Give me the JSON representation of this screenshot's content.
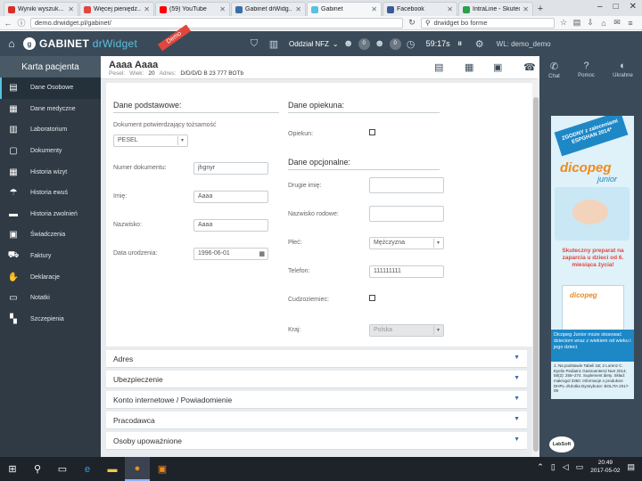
{
  "browser": {
    "tabs": [
      {
        "title": "Wyniki wyszuk...",
        "color": "#d93025",
        "active": false
      },
      {
        "title": "Więcej pieniędz...",
        "color": "#e2463c",
        "active": false
      },
      {
        "title": "(59) YouTube",
        "color": "#ff0000",
        "active": false
      },
      {
        "title": "Gabinet drWidg...",
        "color": "#3b6ea8",
        "active": false
      },
      {
        "title": "Gabinet",
        "color": "#59c1e0",
        "active": true
      },
      {
        "title": "Facebook",
        "color": "#3b5998",
        "active": false
      },
      {
        "title": "IntraLine - Skuteczn...",
        "color": "#2aa14a",
        "active": false
      }
    ],
    "new_tab": "+",
    "url": "demo.drwidget.pl/gabinet/",
    "search": "drwidget bo forme"
  },
  "header": {
    "logo": "GABINET",
    "logo_dr": "drWidget",
    "demo": "Demo",
    "oddzial": "Oddział NFZ",
    "badge1": "0",
    "badge2": "0",
    "time": "59:17s",
    "user": "WL: demo_demo"
  },
  "sidebar": {
    "title": "Karta pacjenta",
    "items": [
      {
        "label": "Dane Osobowe",
        "icon": "id-card-icon",
        "glyph": "▤"
      },
      {
        "label": "Dane medyczne",
        "icon": "medical-file-icon",
        "glyph": "▦"
      },
      {
        "label": "Laboratorium",
        "icon": "lab-icon",
        "glyph": "▥"
      },
      {
        "label": "Dokumenty",
        "icon": "documents-icon",
        "glyph": "▢"
      },
      {
        "label": "Historia wizyt",
        "icon": "calendar-icon",
        "glyph": "▦"
      },
      {
        "label": "Historia ewuś",
        "icon": "umbrella-icon",
        "glyph": "☂"
      },
      {
        "label": "Historia zwolnień",
        "icon": "bed-icon",
        "glyph": "▬"
      },
      {
        "label": "Świadczenia",
        "icon": "clipboard-icon",
        "glyph": "▣"
      },
      {
        "label": "Faktury",
        "icon": "cart-icon",
        "glyph": "⛟"
      },
      {
        "label": "Deklaracje",
        "icon": "handshake-icon",
        "glyph": "✋"
      },
      {
        "label": "Notatki",
        "icon": "notes-icon",
        "glyph": "▭"
      },
      {
        "label": "Szczepienia",
        "icon": "grid-icon",
        "glyph": "▚"
      }
    ]
  },
  "patient": {
    "name": "Aaaa Aaaa",
    "pesel_label": "Pesel:",
    "wiek_label": "Wiek:",
    "wiek": "20",
    "adres_label": "Adres:",
    "adres": "D/D/D/D B 23 777 BOTb"
  },
  "right_panel": {
    "btn1": "Chat",
    "btn2": "Pomoc",
    "btn3": "Ukrahne"
  },
  "form": {
    "basic_title": "Dane podstawowe:",
    "doc_type_label": "Dokument potwierdzający tożsamość",
    "doc_type_value": "PESEL",
    "doc_number_label": "Numer dokumentu:",
    "doc_number_value": "jhgnyr",
    "first_name_label": "Imię:",
    "first_name_value": "Aaaa",
    "last_name_label": "Nazwisko:",
    "last_name_value": "Aaaa",
    "dob_label": "Data urodzenia:",
    "dob_value": "1996-06-01",
    "guardian_title": "Dane opiekuna:",
    "guardian_label": "Opiekun:",
    "optional_title": "Dane opcjonalne:",
    "second_name_label": "Drugie imię:",
    "family_name_label": "Nazwisko rodowe:",
    "sex_label": "Płeć:",
    "sex_value": "Mężczyzna",
    "phone_label": "Telefon:",
    "phone_value": "111111111",
    "foreigner_label": "Cudzoziemiec:",
    "country_label": "Kraj:",
    "country_value": "Polska"
  },
  "accordions": [
    "Adres",
    "Ubezpieczenie",
    "Konto internetowe / Powiadomienie",
    "Pracodawca",
    "Osoby upoważnione"
  ],
  "ad": {
    "badge": "ZGODNY z zaleceniami ESPGHAN 2014*",
    "brand": "dicopeg",
    "sub": "junior",
    "tagline": "Skuteczny preparat na zaparcia u dzieci od 6. miesiąca życia!",
    "blue_text": "Dicopeg Junior może stosować dzieciom wraz z wiekiem od wieku i jego dzieci.",
    "fine_print": "1. Na podstawie Tabeli 1B; 2 Lorenz C. Eyelin Pediatric Gastroenterol Nutr 2014; 58(2): 258–274. Suplement diety. Skład: makrogol 3350. Informacje o produkcie DHPL-J/Ulotka Dystrybutor: BOLITA 2017-08",
    "labsoft": "LabSoft"
  },
  "taskbar": {
    "clock_time": "20:49",
    "clock_date": "2017-05-02"
  }
}
